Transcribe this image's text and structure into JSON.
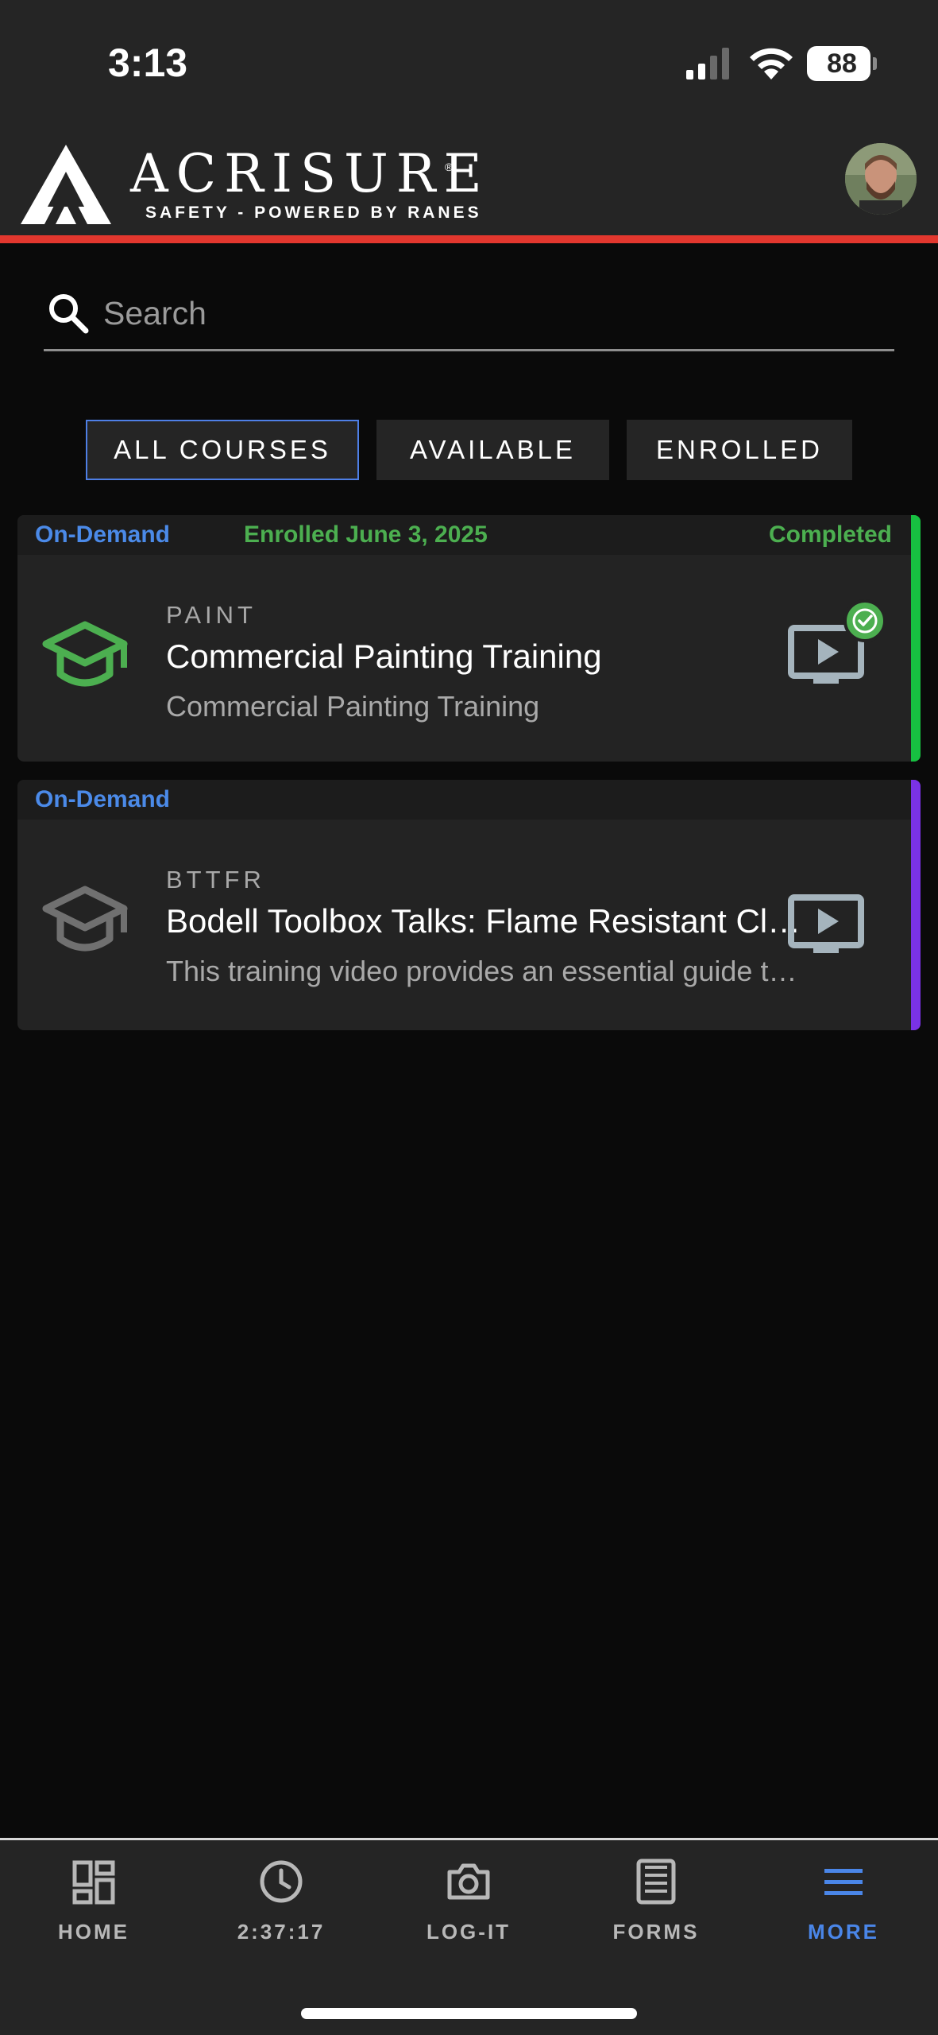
{
  "status_bar": {
    "time": "3:13",
    "battery_percent": "88"
  },
  "header": {
    "brand_name": "ACRISURE",
    "brand_registered": "®",
    "brand_subtitle": "SAFETY - POWERED BY RANES",
    "accent_color": "#e2372e"
  },
  "search": {
    "placeholder": "Search",
    "value": ""
  },
  "filters": {
    "tabs": [
      {
        "label": "ALL COURSES",
        "active": true
      },
      {
        "label": "AVAILABLE",
        "active": false
      },
      {
        "label": "ENROLLED",
        "active": false
      }
    ]
  },
  "courses": [
    {
      "type": "On-Demand",
      "enrolled": "Enrolled June 3, 2025",
      "status": "Completed",
      "code": "PAINT",
      "title": "Commercial Painting Training",
      "description": "Commercial Painting Training",
      "accent_color": "#17c041",
      "icon": "graduation-cap-icon",
      "media_icon": "video-icon",
      "completed": true
    },
    {
      "type": "On-Demand",
      "code": "BTTFR",
      "title": "Bodell Toolbox Talks: Flame Resistant Clothing",
      "description": "This training video provides an essential guide to flame resistant clothing",
      "accent_color": "#7a32e6",
      "icon": "graduation-cap-icon",
      "media_icon": "video-icon",
      "completed": false
    }
  ],
  "bottom_nav": {
    "items": [
      {
        "label": "HOME",
        "icon": "dashboard-icon"
      },
      {
        "label": "2:37:17",
        "icon": "clock-icon"
      },
      {
        "label": "LOG-IT",
        "icon": "camera-icon"
      },
      {
        "label": "FORMS",
        "icon": "form-icon"
      },
      {
        "label": "MORE",
        "icon": "menu-icon",
        "active": true
      }
    ]
  }
}
